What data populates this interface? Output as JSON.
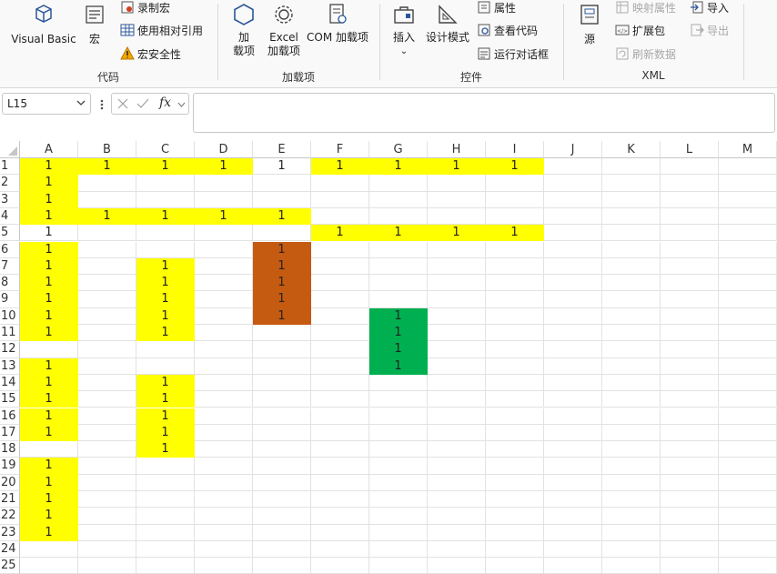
{
  "ribbon": {
    "code_group": {
      "label": "代码",
      "visual_basic": "Visual Basic",
      "macro": "宏",
      "record_macro": "录制宏",
      "relative_ref": "使用相对引用",
      "macro_security": "宏安全性"
    },
    "addins_group": {
      "label": "加载项",
      "addins_line1": "加",
      "addins_line2": "载项",
      "excel_line1": "Excel",
      "excel_line2": "加载项",
      "com_addins": "COM 加载项"
    },
    "controls_group": {
      "label": "控件",
      "insert": "插入",
      "insert_caret": "⌄",
      "design_mode": "设计模式",
      "properties": "属性",
      "view_code": "查看代码",
      "run_dialog": "运行对话框"
    },
    "xml_group": {
      "label": "XML",
      "source": "源",
      "map_properties": "映射属性",
      "expansion_packs": "扩展包",
      "refresh_data": "刷新数据",
      "import": "导入",
      "export": "导出"
    }
  },
  "formula_bar": {
    "name_box": "L15",
    "fx": "fx",
    "formula": ""
  },
  "colors": {
    "yellow": "#ffff00",
    "orange": "#c55a11",
    "green": "#00b050"
  },
  "columns": [
    "A",
    "B",
    "C",
    "D",
    "E",
    "F",
    "G",
    "H",
    "I",
    "J",
    "K",
    "L",
    "M"
  ],
  "rows": [
    "1",
    "2",
    "3",
    "4",
    "5",
    "6",
    "7",
    "8",
    "9",
    "10",
    "11",
    "12",
    "13",
    "14",
    "15",
    "16",
    "17",
    "18",
    "19",
    "20",
    "21",
    "22",
    "23",
    "24",
    "25"
  ],
  "cells": [
    {
      "r": 1,
      "c": 0,
      "v": "1",
      "bg": "yellow"
    },
    {
      "r": 1,
      "c": 1,
      "v": "1",
      "bg": "yellow"
    },
    {
      "r": 1,
      "c": 2,
      "v": "1",
      "bg": "yellow"
    },
    {
      "r": 1,
      "c": 3,
      "v": "1",
      "bg": "yellow"
    },
    {
      "r": 1,
      "c": 4,
      "v": "1",
      "bg": ""
    },
    {
      "r": 1,
      "c": 5,
      "v": "1",
      "bg": "yellow"
    },
    {
      "r": 1,
      "c": 6,
      "v": "1",
      "bg": "yellow"
    },
    {
      "r": 1,
      "c": 7,
      "v": "1",
      "bg": "yellow"
    },
    {
      "r": 1,
      "c": 8,
      "v": "1",
      "bg": "yellow"
    },
    {
      "r": 2,
      "c": 0,
      "v": "1",
      "bg": "yellow"
    },
    {
      "r": 3,
      "c": 0,
      "v": "1",
      "bg": "yellow"
    },
    {
      "r": 4,
      "c": 0,
      "v": "1",
      "bg": "yellow"
    },
    {
      "r": 4,
      "c": 1,
      "v": "1",
      "bg": "yellow"
    },
    {
      "r": 4,
      "c": 2,
      "v": "1",
      "bg": "yellow"
    },
    {
      "r": 4,
      "c": 3,
      "v": "1",
      "bg": "yellow"
    },
    {
      "r": 4,
      "c": 4,
      "v": "1",
      "bg": "yellow"
    },
    {
      "r": 5,
      "c": 0,
      "v": "1",
      "bg": ""
    },
    {
      "r": 5,
      "c": 5,
      "v": "1",
      "bg": "yellow"
    },
    {
      "r": 5,
      "c": 6,
      "v": "1",
      "bg": "yellow"
    },
    {
      "r": 5,
      "c": 7,
      "v": "1",
      "bg": "yellow"
    },
    {
      "r": 5,
      "c": 8,
      "v": "1",
      "bg": "yellow"
    },
    {
      "r": 6,
      "c": 0,
      "v": "1",
      "bg": "yellow"
    },
    {
      "r": 6,
      "c": 4,
      "v": "1",
      "bg": "orange"
    },
    {
      "r": 7,
      "c": 0,
      "v": "1",
      "bg": "yellow"
    },
    {
      "r": 7,
      "c": 2,
      "v": "1",
      "bg": "yellow"
    },
    {
      "r": 7,
      "c": 4,
      "v": "1",
      "bg": "orange"
    },
    {
      "r": 8,
      "c": 0,
      "v": "1",
      "bg": "yellow"
    },
    {
      "r": 8,
      "c": 2,
      "v": "1",
      "bg": "yellow"
    },
    {
      "r": 8,
      "c": 4,
      "v": "1",
      "bg": "orange"
    },
    {
      "r": 9,
      "c": 0,
      "v": "1",
      "bg": "yellow"
    },
    {
      "r": 9,
      "c": 2,
      "v": "1",
      "bg": "yellow"
    },
    {
      "r": 9,
      "c": 4,
      "v": "1",
      "bg": "orange"
    },
    {
      "r": 10,
      "c": 0,
      "v": "1",
      "bg": "yellow"
    },
    {
      "r": 10,
      "c": 2,
      "v": "1",
      "bg": "yellow"
    },
    {
      "r": 10,
      "c": 4,
      "v": "1",
      "bg": "orange"
    },
    {
      "r": 10,
      "c": 6,
      "v": "1",
      "bg": "green"
    },
    {
      "r": 11,
      "c": 0,
      "v": "1",
      "bg": "yellow"
    },
    {
      "r": 11,
      "c": 2,
      "v": "1",
      "bg": "yellow"
    },
    {
      "r": 11,
      "c": 6,
      "v": "1",
      "bg": "green"
    },
    {
      "r": 12,
      "c": 6,
      "v": "1",
      "bg": "green"
    },
    {
      "r": 13,
      "c": 0,
      "v": "1",
      "bg": "yellow"
    },
    {
      "r": 13,
      "c": 6,
      "v": "1",
      "bg": "green"
    },
    {
      "r": 14,
      "c": 0,
      "v": "1",
      "bg": "yellow"
    },
    {
      "r": 14,
      "c": 2,
      "v": "1",
      "bg": "yellow"
    },
    {
      "r": 15,
      "c": 0,
      "v": "1",
      "bg": "yellow"
    },
    {
      "r": 15,
      "c": 2,
      "v": "1",
      "bg": "yellow"
    },
    {
      "r": 16,
      "c": 0,
      "v": "1",
      "bg": "yellow"
    },
    {
      "r": 16,
      "c": 2,
      "v": "1",
      "bg": "yellow"
    },
    {
      "r": 17,
      "c": 0,
      "v": "1",
      "bg": "yellow"
    },
    {
      "r": 17,
      "c": 2,
      "v": "1",
      "bg": "yellow"
    },
    {
      "r": 18,
      "c": 2,
      "v": "1",
      "bg": "yellow"
    },
    {
      "r": 19,
      "c": 0,
      "v": "1",
      "bg": "yellow"
    },
    {
      "r": 20,
      "c": 0,
      "v": "1",
      "bg": "yellow"
    },
    {
      "r": 21,
      "c": 0,
      "v": "1",
      "bg": "yellow"
    },
    {
      "r": 22,
      "c": 0,
      "v": "1",
      "bg": "yellow"
    },
    {
      "r": 23,
      "c": 0,
      "v": "1",
      "bg": "yellow"
    }
  ]
}
